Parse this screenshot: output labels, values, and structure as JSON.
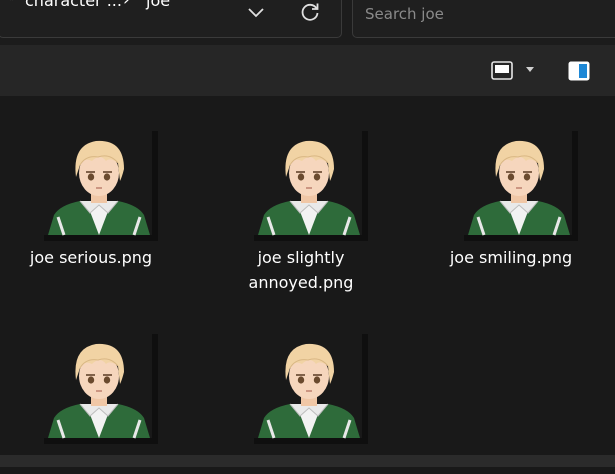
{
  "breadcrumb": {
    "overflow_glyph": "«",
    "parent": "character ...",
    "separator": "›",
    "current": "joe"
  },
  "search": {
    "placeholder": "Search joe",
    "value": ""
  },
  "toolbar": {
    "view_icon": "layout-icon",
    "details_icon": "details-pane-icon"
  },
  "colors": {
    "background": "#191919",
    "toolbar": "#262626",
    "jacket": "#2e6b3a",
    "hair": "#f1d3a4"
  },
  "files": [
    {
      "name": "joe serious.png"
    },
    {
      "name": "joe slightly annoyed.png"
    },
    {
      "name": "joe smiling.png"
    },
    {
      "name": ""
    },
    {
      "name": ""
    }
  ]
}
